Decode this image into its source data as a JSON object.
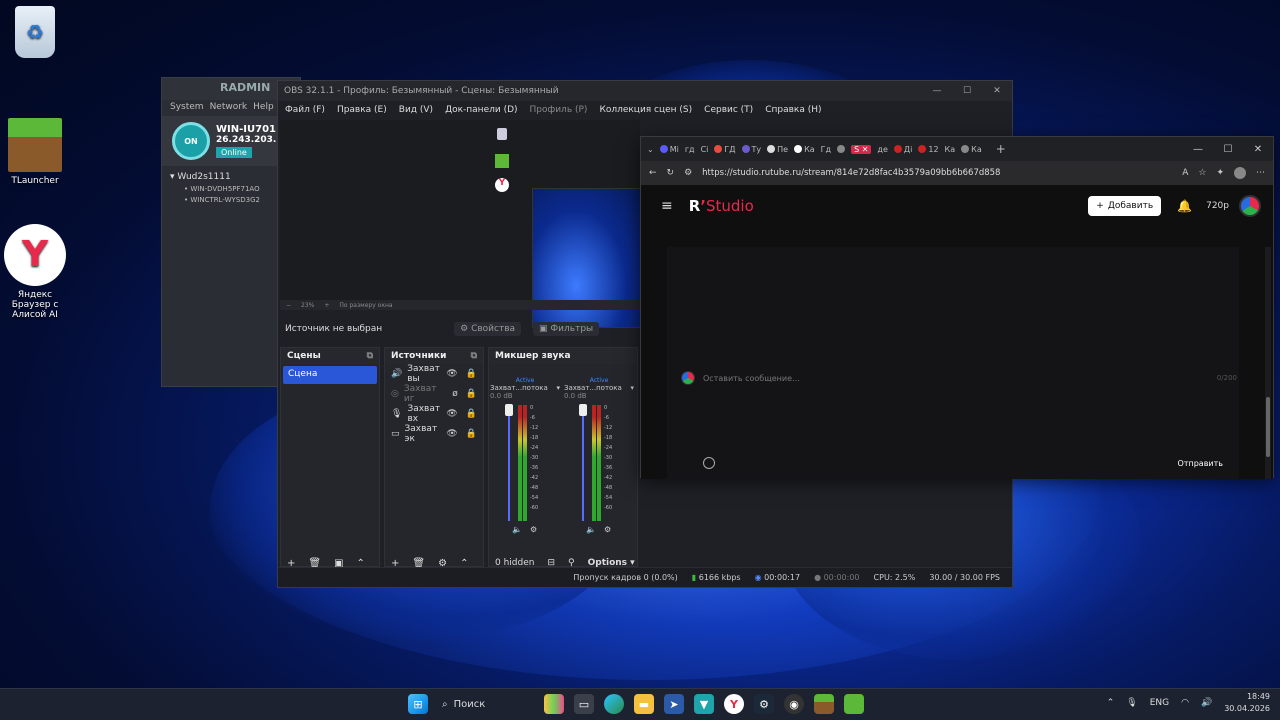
{
  "desktop": {
    "icons": [
      {
        "label": ""
      },
      {
        "label": "TLauncher"
      },
      {
        "label": "Яндекс Браузер с Алисой AI"
      }
    ]
  },
  "radmin": {
    "title": "RADMIN",
    "menu": [
      "System",
      "Network",
      "Help"
    ],
    "power": "ON",
    "name": "WIN-IU701",
    "ip": "26.243.203.75",
    "status": "Online",
    "network": "Wud2s1111",
    "members": [
      "WIN-DVDH5PF71AO",
      "WINCTRL-WYSD3G2"
    ]
  },
  "obs": {
    "title": "OBS 32.1.1 - Профиль: Безымянный - Сцены: Безымянный",
    "menu": [
      "Файл (F)",
      "Правка (E)",
      "Вид (V)",
      "Док-панели (D)",
      "Профиль (P)",
      "Коллекция сцен (S)",
      "Сервис (T)",
      "Справка (H)"
    ],
    "zoom": "23%",
    "zoom_mode": "По размеру окна",
    "source_state": "Источник не выбран",
    "properties": "Свойства",
    "filters": "Фильтры",
    "scenes_title": "Сцены",
    "scenes": [
      "Сцена"
    ],
    "sources_title": "Источники",
    "sources": [
      {
        "label": "Захват вы",
        "icon": "speaker-icon",
        "hidden": false
      },
      {
        "label": "Захват иг",
        "icon": "gamepad-icon",
        "hidden": true
      },
      {
        "label": "Захват вх",
        "icon": "mic-icon",
        "hidden": false
      },
      {
        "label": "Захват эк",
        "icon": "monitor-icon",
        "hidden": false
      }
    ],
    "mixer_title": "Микшер звука",
    "mixer": [
      {
        "name": "Захват...потока",
        "state": "Active",
        "db": "0.0 dB"
      },
      {
        "name": "Захват...потока",
        "state": "Active",
        "db": "0.0 dB"
      }
    ],
    "meter_ticks": [
      "0",
      "-6",
      "-12",
      "-18",
      "-24",
      "-30",
      "-36",
      "-42",
      "-48",
      "-54",
      "-60"
    ],
    "hidden_count": "0 hidden",
    "options": "Options",
    "status": {
      "dropped": "Пропуск кадров 0 (0.0%)",
      "bitrate": "6166 kbps",
      "time1": "00:00:17",
      "time2": "00:00:00",
      "cpu": "CPU: 2.5%",
      "fps": "30.00 / 30.00 FPS"
    }
  },
  "browser": {
    "tabs": [
      "Мі",
      "гд",
      "Сі",
      "ГД",
      "Ту",
      "Пе",
      "Ка",
      "Гд",
      "Ка",
      "де",
      "Ді",
      "12",
      "Ка",
      "Ка"
    ],
    "url": "https://studio.rutube.ru/stream/814e72d8fac4b3579a09bb6b667d858",
    "logo_r": "R",
    "logo_studio": "Studio",
    "add_button": "Добавить",
    "resolution": "720p",
    "message_placeholder": "Оставить сообщение...",
    "char_count": "0/200",
    "send": "Отправить"
  },
  "taskbar": {
    "search": "Поиск",
    "lang": "ENG",
    "time": "18:49",
    "date": "30.04.2026"
  }
}
